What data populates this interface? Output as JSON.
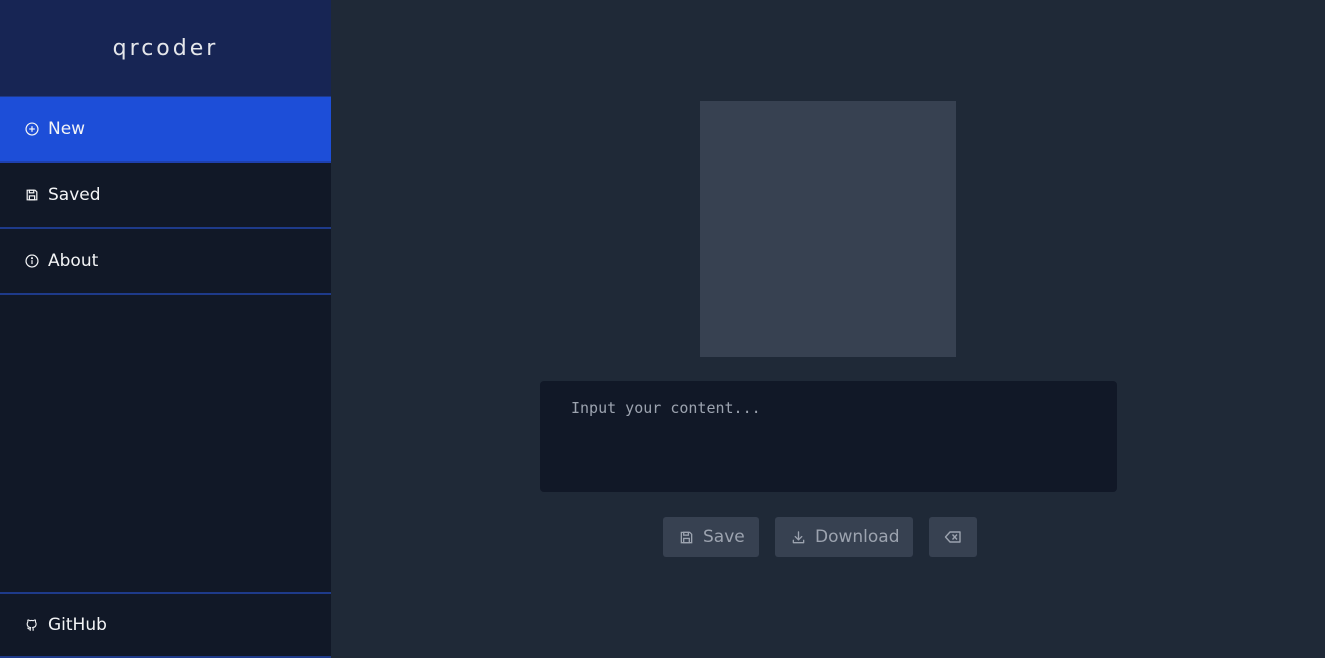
{
  "app": {
    "title": "qrcoder"
  },
  "sidebar": {
    "items": [
      {
        "label": "New",
        "icon": "plus-circle-icon",
        "active": true
      },
      {
        "label": "Saved",
        "icon": "floppy-disk-icon",
        "active": false
      },
      {
        "label": "About",
        "icon": "info-circle-icon",
        "active": false
      }
    ],
    "footer": {
      "label": "GitHub",
      "icon": "github-icon"
    }
  },
  "main": {
    "input": {
      "placeholder": "Input your content...",
      "value": ""
    },
    "buttons": {
      "save_label": "Save",
      "download_label": "Download",
      "clear_icon": "backspace-icon"
    }
  },
  "colors": {
    "accent": "#1d4ed8",
    "sidebar_bg": "#111827",
    "brand_bg": "#172554",
    "main_bg": "#1f2937",
    "divider": "#1e3a8a"
  }
}
